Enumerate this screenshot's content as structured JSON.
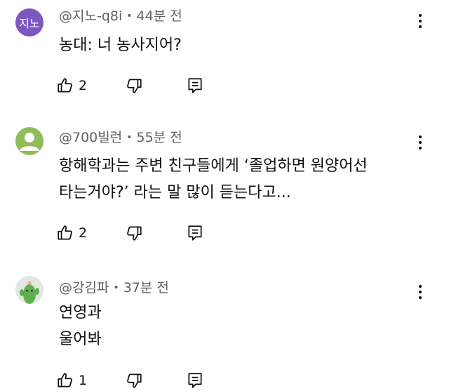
{
  "comments": [
    {
      "avatar_text": "지노",
      "avatar_color": "#7d57c1",
      "handle": "@지노-q8i",
      "separator": "•",
      "time": "44분 전",
      "lines": [
        "농대: 너 농사지어?"
      ],
      "likes": "2"
    },
    {
      "avatar_text": "",
      "avatar_color": "#8ebd5a",
      "handle": "@700빌런",
      "separator": "•",
      "time": "55분 전",
      "lines": [
        "항해학과는 주변 친구들에게 ‘졸업하면 원양어선",
        "타는거야?’ 라는 말 많이 듣는다고..."
      ],
      "likes": "2"
    },
    {
      "avatar_text": "",
      "avatar_color": "#e3e6e3",
      "handle": "@강김파",
      "separator": "•",
      "time": "37분 전",
      "lines": [
        "연영과",
        "울어봐"
      ],
      "likes": "1"
    }
  ],
  "icons": {
    "like": "thumbs-up-icon",
    "dislike": "thumbs-down-icon",
    "reply": "reply-icon",
    "menu": "more-vert-icon"
  }
}
